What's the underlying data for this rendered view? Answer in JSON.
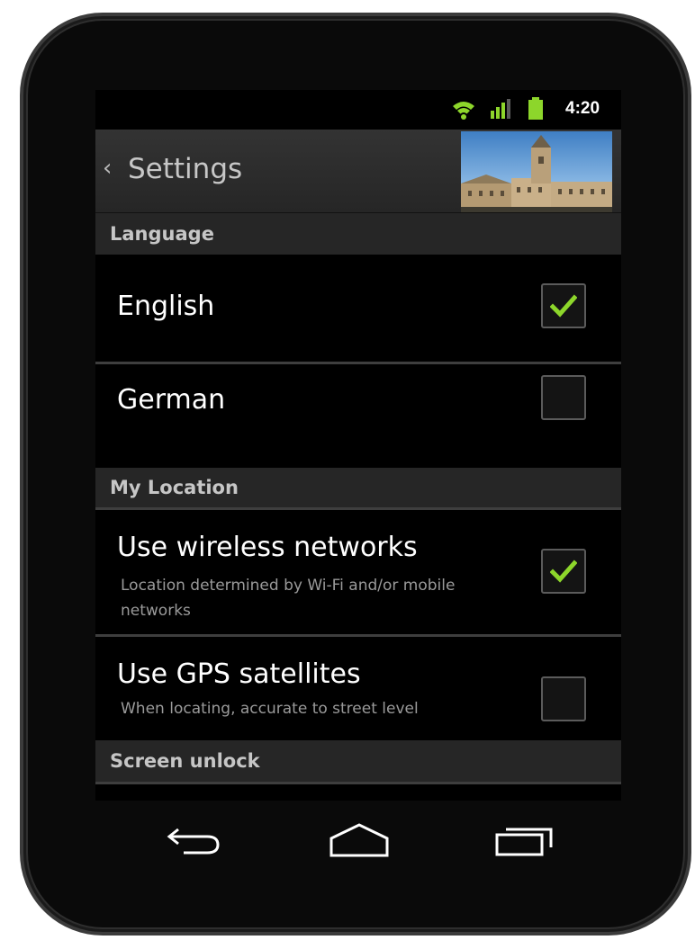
{
  "status_bar": {
    "time": "4:20",
    "icons": [
      "wifi-icon",
      "signal-icon",
      "battery-icon"
    ],
    "accent_color": "#8dd62b"
  },
  "action_bar": {
    "back_glyph": "‹",
    "title": "Settings"
  },
  "sections": {
    "language": {
      "header": "Language",
      "items": [
        {
          "label": "English",
          "checked": true
        },
        {
          "label": "German",
          "checked": false
        }
      ]
    },
    "location": {
      "header": "My Location",
      "items": [
        {
          "label": "Use wireless networks",
          "summary": "Location determined by Wi-Fi and/or mobile networks",
          "checked": true
        },
        {
          "label": "Use GPS satellites",
          "summary": "When locating, accurate to street level",
          "checked": false
        }
      ]
    },
    "screen_unlock": {
      "header": "Screen unlock"
    }
  },
  "nav_bar": {
    "buttons": [
      "back-icon",
      "home-icon",
      "recent-apps-icon"
    ]
  }
}
